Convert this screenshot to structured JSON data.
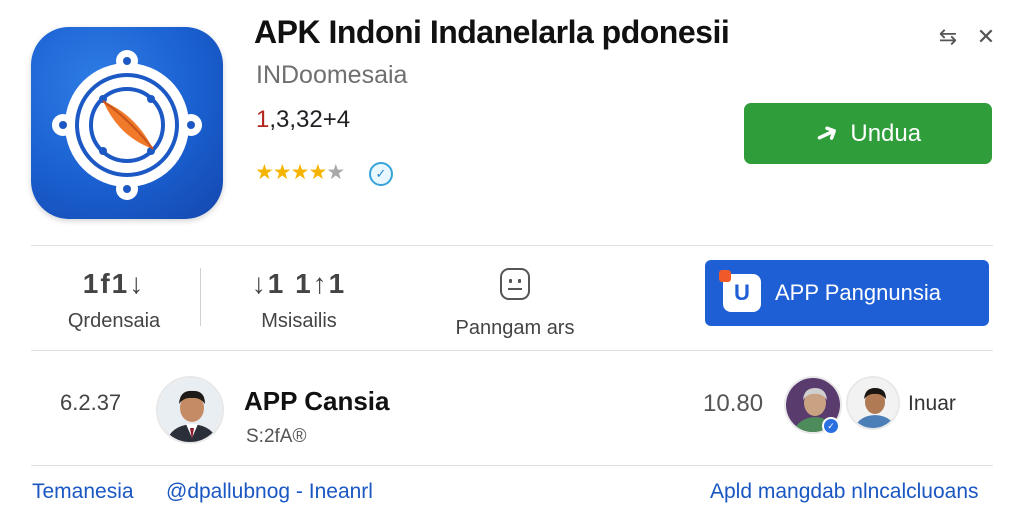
{
  "app": {
    "title": "APK Indoni Indanelarla pdonesii",
    "developer": "INDoomesaia",
    "count_first": "1",
    "count_rest": ",3,32+4",
    "rating": 4,
    "rating_max": 5,
    "verified_icon": "verified-badge-icon",
    "install_label": "Undua",
    "icon": "compass-icon"
  },
  "top_icons": [
    "share-icon",
    "close-icon"
  ],
  "stats": [
    {
      "glyph": "1f1↓",
      "label": "Qrdensaia"
    },
    {
      "glyph": "↓1 1↑1",
      "label": "Msisailis"
    },
    {
      "glyph": "",
      "label": "Panngam ars"
    }
  ],
  "promo": {
    "label": "APP Pangnunsia",
    "logo_glyph": "U"
  },
  "review": {
    "left_number": "6.2.37",
    "name": "APP Cansia",
    "sub": "S:2fA®",
    "right_number": "10.80",
    "right_label": "Inuar"
  },
  "footer": {
    "left": "Temanesia",
    "middle": "@dpallubnog - Ineanrl",
    "right": "Apld mangdab nlncalcluoans"
  },
  "colors": {
    "install": "#2e9d3a",
    "promo": "#1f5fd6",
    "icon_bg": "#1a5fd0",
    "footer_link": "#1a57c2"
  }
}
